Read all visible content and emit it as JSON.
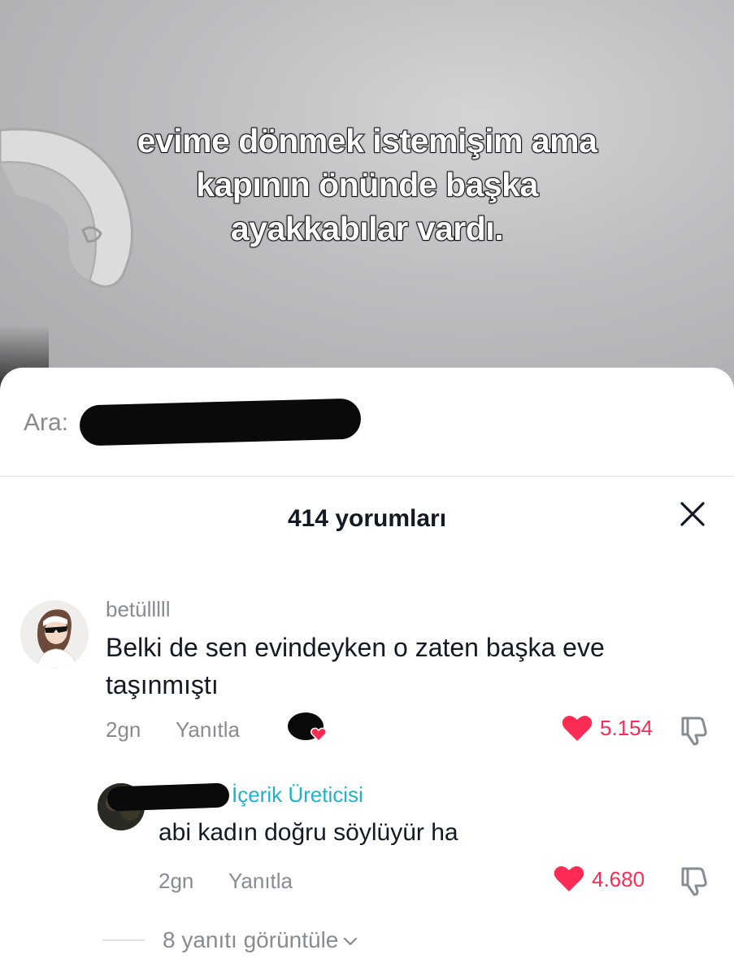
{
  "video": {
    "caption_lines": [
      "evime dönmek istemişim ama",
      "kapının önünde başka",
      "ayakkabılar vardı."
    ]
  },
  "search": {
    "prefix": "Ara:"
  },
  "comments_panel": {
    "title": "414 yorumları",
    "close_icon": "close-icon"
  },
  "comment": {
    "username": "betülllll",
    "text": "Belki de sen evindeyken o zaten başka eve taşınmıştı",
    "time": "2gn",
    "reply_label": "Yanıtla",
    "likes": "5.154",
    "like_color": "#fe2c55"
  },
  "reply": {
    "creator_badge": "İçerik Üreticisi",
    "text": "abi kadın doğru söylüyür ha",
    "time": "2gn",
    "reply_label": "Yanıtla",
    "likes": "4.680",
    "badge_color": "#20b2c8"
  },
  "view_replies": {
    "label": "8 yanıtı görüntüle"
  }
}
